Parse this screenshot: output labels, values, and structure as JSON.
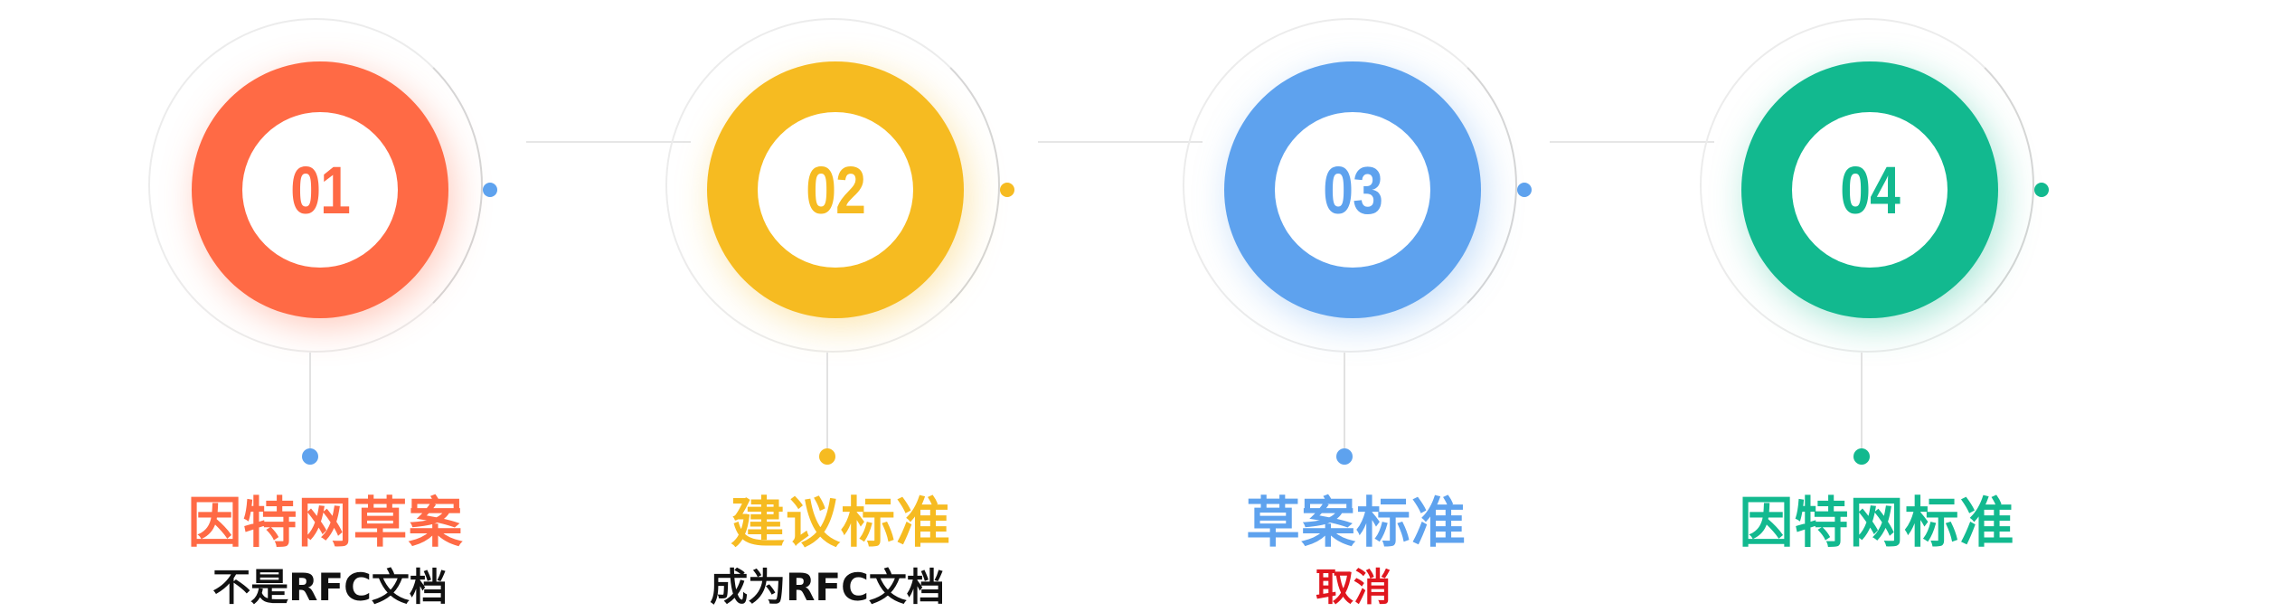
{
  "steps": [
    {
      "number": "01",
      "title": "因特网草案",
      "subtitle": "不是RFC文档",
      "color": "#FF6A45",
      "subtitle_color": "#111111"
    },
    {
      "number": "02",
      "title": "建议标准",
      "subtitle": "成为RFC文档",
      "color": "#F6BB21",
      "subtitle_color": "#111111"
    },
    {
      "number": "03",
      "title": "草案标准",
      "subtitle": "取消",
      "color": "#5EA2EE",
      "subtitle_color": "#E0161E"
    },
    {
      "number": "04",
      "title": "因特网标准",
      "subtitle": "",
      "color": "#12B98F",
      "subtitle_color": "#111111"
    }
  ]
}
